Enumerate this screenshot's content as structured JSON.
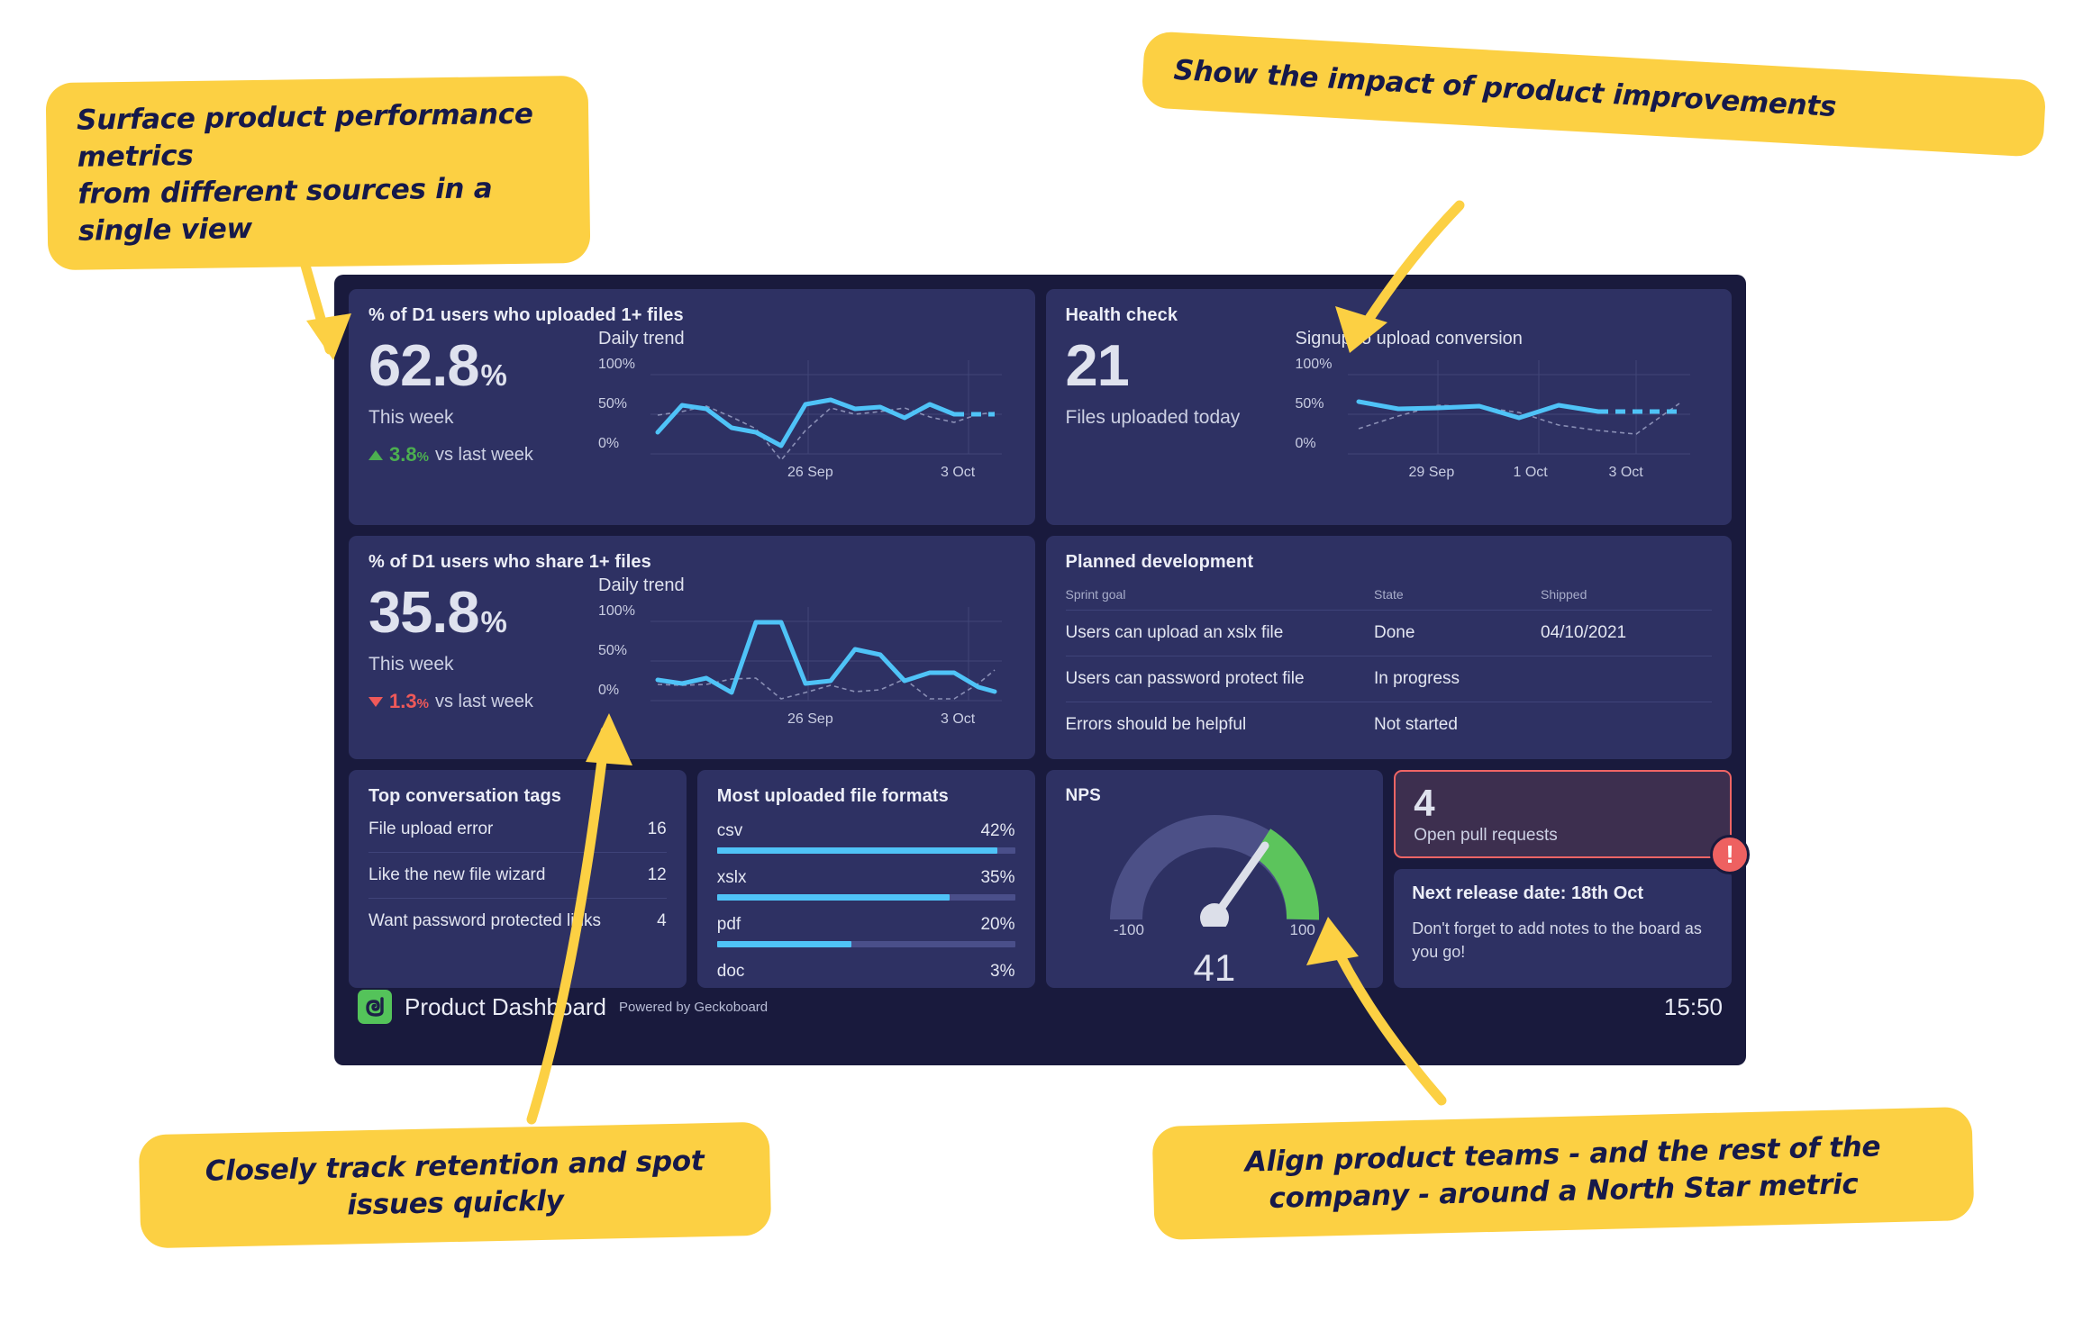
{
  "callouts": [
    {
      "id": "callout-1",
      "lines": [
        "Surface product performance metrics",
        "from different sources in a single view"
      ]
    },
    {
      "id": "callout-2",
      "lines": [
        "Show the impact of product improvements"
      ]
    },
    {
      "id": "callout-3",
      "lines": [
        "Closely track retention and spot",
        "issues quickly"
      ]
    },
    {
      "id": "callout-4",
      "lines": [
        "Align product teams - and the rest of the",
        "company - around a North Star metric"
      ]
    }
  ],
  "colors": {
    "accent_blue": "#4fc3f7",
    "positive_green": "#4caf50",
    "negative_red": "#ef5959",
    "callout_yellow": "#fcd043",
    "card_bg": "#2e3163",
    "dash_bg": "#191a3d",
    "alert_red": "#ee6161",
    "gauge_green": "#5cc45c",
    "gauge_track": "#4c5087",
    "logo_green": "#54c35a"
  },
  "widgets": {
    "uploaded": {
      "title": "% of D1 users who uploaded 1+ files",
      "value": "62.8",
      "unit": "%",
      "period": "This week",
      "delta_value": "3.8",
      "delta_unit": "%",
      "delta_suffix": "vs last week",
      "delta_direction": "up",
      "trend_title": "Daily trend"
    },
    "health": {
      "title": "Health check",
      "value": "21",
      "period": "Files uploaded today",
      "trend_title": "Signup to upload conversion"
    },
    "shared": {
      "title": "% of D1 users who share 1+ files",
      "value": "35.8",
      "unit": "%",
      "period": "This week",
      "delta_value": "1.3",
      "delta_unit": "%",
      "delta_suffix": "vs last week",
      "delta_direction": "down",
      "trend_title": "Daily trend"
    },
    "planned": {
      "title": "Planned development",
      "headers": [
        "Sprint goal",
        "State",
        "Shipped"
      ],
      "rows": [
        {
          "goal": "Users can upload an xslx file",
          "state": "Done",
          "shipped": "04/10/2021"
        },
        {
          "goal": "Users can password protect file",
          "state": "In progress",
          "shipped": ""
        },
        {
          "goal": "Errors should be helpful",
          "state": "Not started",
          "shipped": ""
        }
      ]
    },
    "tags": {
      "title": "Top conversation tags",
      "rows": [
        {
          "label": "File upload error",
          "count": "16"
        },
        {
          "label": "Like the new file wizard",
          "count": "12"
        },
        {
          "label": "Want password protected links",
          "count": "4"
        }
      ]
    },
    "formats": {
      "title": "Most uploaded file formats",
      "rows": [
        {
          "label": "csv",
          "pct": "42%",
          "value": 42
        },
        {
          "label": "xslx",
          "pct": "35%",
          "value": 35
        },
        {
          "label": "pdf",
          "pct": "20%",
          "value": 20
        },
        {
          "label": "doc",
          "pct": "3%",
          "value": 3
        }
      ]
    },
    "nps": {
      "title": "NPS",
      "min_label": "-100",
      "max_label": "100",
      "value": "41"
    },
    "pull_requests": {
      "value": "4",
      "label": "Open pull requests",
      "alert_icon": "exclamation-icon"
    },
    "note": {
      "title": "Next release date: 18th Oct",
      "body": "Don't forget to add notes to the board as you go!"
    }
  },
  "footer": {
    "logo_icon": "geckoboard-logo",
    "title": "Product Dashboard",
    "powered_by": "Powered by Geckoboard",
    "time": "15:50"
  },
  "chart_data": [
    {
      "type": "line",
      "name": "uploaded_daily_trend",
      "title": "Daily trend",
      "ylabel": "",
      "xlabel": "",
      "ylim": [
        0,
        100
      ],
      "yticks": [
        "0%",
        "50%",
        "100%"
      ],
      "xticks": [
        "26 Sep",
        "3 Oct"
      ],
      "grid": true,
      "series": [
        {
          "name": "current",
          "style": "solid",
          "color": "#4fc3f7",
          "values": [
            27,
            61,
            57,
            33,
            28,
            11,
            62,
            68,
            57,
            59,
            45,
            62,
            51,
            51,
            51
          ]
        },
        {
          "name": "previous",
          "style": "dashed",
          "color": "#8a8fb5",
          "values": [
            48,
            53,
            60,
            47,
            33,
            -8,
            30,
            58,
            50,
            53,
            58,
            46,
            40,
            50,
            52
          ]
        }
      ]
    },
    {
      "type": "line",
      "name": "signup_to_upload_conversion",
      "title": "Signup to upload conversion",
      "ylim": [
        0,
        100
      ],
      "yticks": [
        "0%",
        "50%",
        "100%"
      ],
      "xticks": [
        "29 Sep",
        "1 Oct",
        "3 Oct"
      ],
      "grid": true,
      "series": [
        {
          "name": "current",
          "style": "solid",
          "color": "#4fc3f7",
          "values": [
            64,
            55,
            57,
            59,
            45,
            59,
            52,
            52,
            52
          ]
        },
        {
          "name": "previous",
          "style": "dashed",
          "color": "#8a8fb5",
          "values": [
            30,
            58,
            58,
            55,
            36,
            30,
            24,
            21,
            62
          ]
        }
      ]
    },
    {
      "type": "line",
      "name": "shared_daily_trend",
      "title": "Daily trend",
      "ylim": [
        0,
        100
      ],
      "yticks": [
        "0%",
        "50%",
        "100%"
      ],
      "xticks": [
        "26 Sep",
        "3 Oct"
      ],
      "grid": true,
      "series": [
        {
          "name": "current",
          "style": "solid",
          "color": "#4fc3f7",
          "values": [
            27,
            22,
            29,
            10,
            93,
            93,
            23,
            26,
            64,
            57,
            26,
            36,
            36,
            20,
            12
          ]
        },
        {
          "name": "previous",
          "style": "dashed",
          "color": "#8a8fb5",
          "values": [
            21,
            20,
            21,
            28,
            29,
            2,
            10,
            19,
            11,
            13,
            27,
            2,
            2,
            22,
            38
          ]
        }
      ]
    },
    {
      "type": "bar",
      "name": "most_uploaded_file_formats",
      "title": "Most uploaded file formats",
      "categories": [
        "csv",
        "xslx",
        "pdf",
        "doc"
      ],
      "values": [
        42,
        35,
        20,
        3
      ],
      "ylim": [
        0,
        100
      ]
    },
    {
      "type": "gauge",
      "name": "nps_gauge",
      "title": "NPS",
      "value": 41,
      "min": -100,
      "max": 100,
      "fill_from": 41,
      "fill_to": 100
    }
  ]
}
